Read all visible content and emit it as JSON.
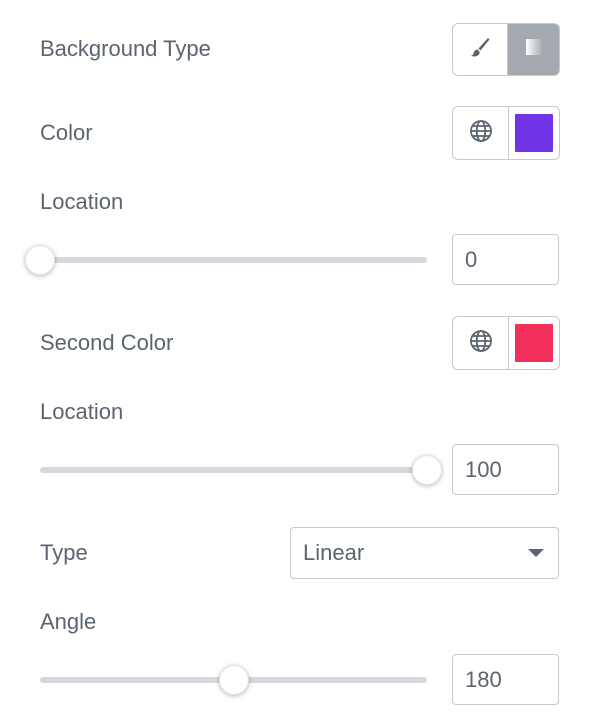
{
  "background_type": {
    "label": "Background Type",
    "options": [
      {
        "icon": "brush-icon",
        "active": false
      },
      {
        "icon": "gradient-icon",
        "active": true
      }
    ]
  },
  "color": {
    "label": "Color",
    "global_icon": "globe-icon",
    "swatch": "#7033e6"
  },
  "location": {
    "label": "Location",
    "value": "0",
    "level_percent": 0
  },
  "second_color": {
    "label": "Second Color",
    "global_icon": "globe-icon",
    "swatch": "#f22e5b"
  },
  "second_location": {
    "label": "Location",
    "value": "100",
    "level_percent": 100
  },
  "type": {
    "label": "Type",
    "selected": "Linear"
  },
  "angle": {
    "label": "Angle",
    "value": "180",
    "level_fraction": 0.5
  },
  "colors": {
    "text": "#5b6470",
    "border": "#c6c9ce",
    "active_toggle": "#a4a9b0",
    "track": "#d5d8dc"
  }
}
